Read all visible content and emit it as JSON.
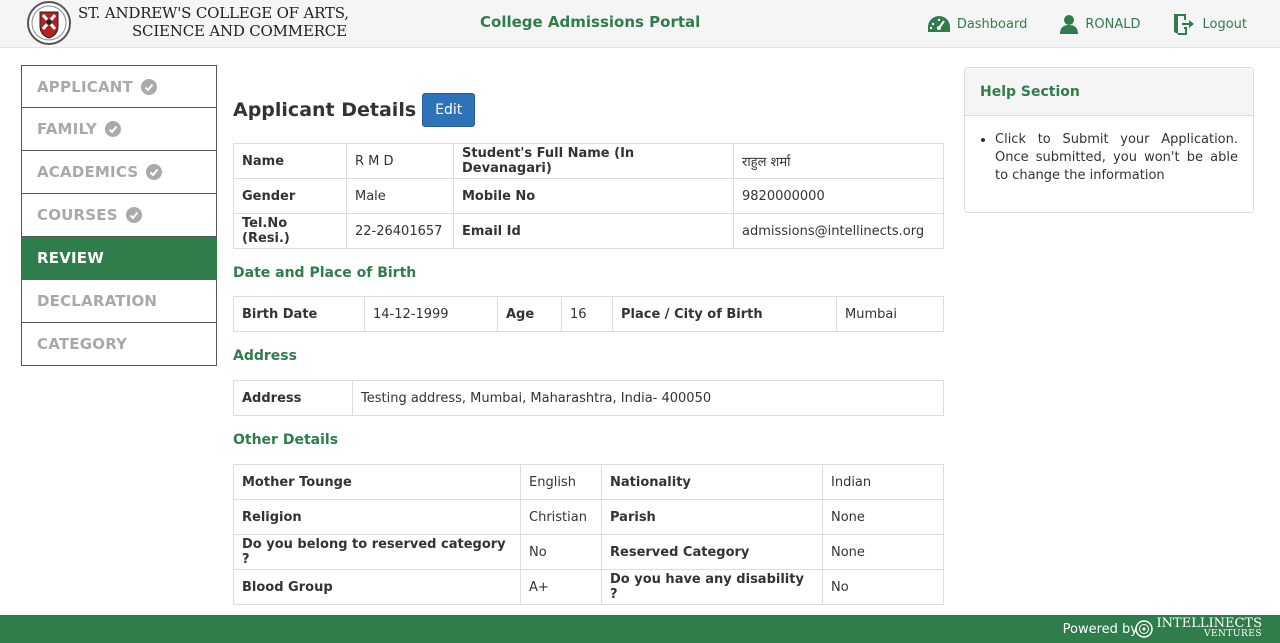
{
  "header": {
    "college_line1": "ST. ANDREW'S COLLEGE OF ARTS,",
    "college_line2": "SCIENCE AND COMMERCE",
    "portal_title": "College Admissions Portal",
    "nav": {
      "dashboard": "Dashboard",
      "user": "RONALD",
      "logout": "Logout"
    }
  },
  "sidebar": {
    "items": [
      {
        "label": "APPLICANT",
        "completed": true
      },
      {
        "label": "FAMILY",
        "completed": true
      },
      {
        "label": "ACADEMICS",
        "completed": true
      },
      {
        "label": "COURSES",
        "completed": true
      },
      {
        "label": "REVIEW",
        "active": true
      },
      {
        "label": "DECLARATION"
      },
      {
        "label": "CATEGORY"
      }
    ]
  },
  "main": {
    "title": "Applicant Details",
    "edit_label": "Edit",
    "applicant": {
      "name_label": "Name",
      "name": "R M D",
      "full_name_label": "Student's Full Name (In Devanagari)",
      "full_name": "राहुल शर्मा",
      "gender_label": "Gender",
      "gender": "Male",
      "mobile_label": "Mobile No",
      "mobile": "9820000000",
      "tel_label": "Tel.No (Resi.)",
      "tel": "22-26401657",
      "email_label": "Email Id",
      "email": "admissions@intellinects.org"
    },
    "birth": {
      "heading": "Date and Place of Birth",
      "date_label": "Birth Date",
      "date": "14-12-1999",
      "age_label": "Age",
      "age": "16",
      "place_label": "Place / City of Birth",
      "place": "Mumbai"
    },
    "address": {
      "heading": "Address",
      "label": "Address",
      "value": "Testing address, Mumbai, Maharashtra, India- 400050"
    },
    "other": {
      "heading": "Other Details",
      "mother_tongue_label": "Mother Tounge",
      "mother_tongue": "English",
      "nationality_label": "Nationality",
      "nationality": "Indian",
      "religion_label": "Religion",
      "religion": "Christian",
      "parish_label": "Parish",
      "parish": "None",
      "reserved_q_label": "Do you belong to reserved category ?",
      "reserved_q": "No",
      "reserved_cat_label": "Reserved Category",
      "reserved_cat": "None",
      "blood_label": "Blood Group",
      "blood": "A+",
      "disability_label": "Do you have any disability ?",
      "disability": "No"
    }
  },
  "help": {
    "title": "Help Section",
    "text": "Click to Submit your Application. Once submitted, you won't be able to change the information"
  },
  "footer": {
    "powered_by": "Powered by",
    "brand": "INTELLINECTS",
    "brand_sub": "VENTURES"
  },
  "colors": {
    "accent": "#2f7d4a",
    "button": "#2e73b8"
  }
}
